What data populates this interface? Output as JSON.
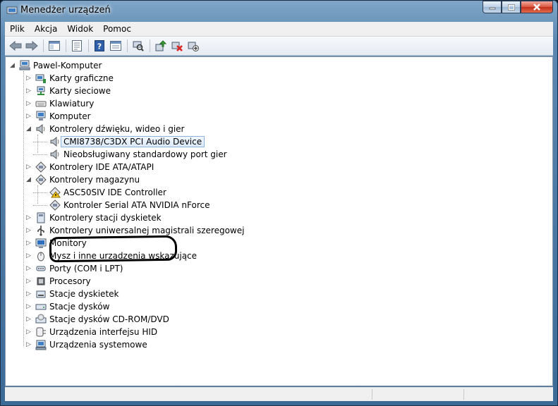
{
  "window": {
    "title": "Menedżer urządzeń"
  },
  "menu": [
    "Plik",
    "Akcja",
    "Widok",
    "Pomoc"
  ],
  "toolbar_icons": [
    "back-arrow-icon",
    "forward-arrow-icon",
    "show-hide-console-tree-icon",
    "properties-icon",
    "help-icon",
    "console-view-icon",
    "scan-hardware-changes-icon",
    "update-driver-icon",
    "uninstall-device-icon",
    "disable-device-icon"
  ],
  "tree": {
    "root": "Pawel-Komputer",
    "categories": [
      {
        "label": "Karty graficzne",
        "icon": "display-adapter-icon"
      },
      {
        "label": "Karty sieciowe",
        "icon": "network-adapter-icon"
      },
      {
        "label": "Klawiatury",
        "icon": "keyboard-icon"
      },
      {
        "label": "Komputer",
        "icon": "computer-icon"
      },
      {
        "label": "Kontrolery dźwięku, wideo i gier",
        "icon": "speaker-icon",
        "expanded": true,
        "children": [
          {
            "label": "CMI8738/C3DX PCI Audio Device",
            "icon": "speaker-icon",
            "selected": true
          },
          {
            "label": "Nieobsługiwany standardowy port gier",
            "icon": "speaker-icon"
          }
        ]
      },
      {
        "label": "Kontrolery IDE ATA/ATAPI",
        "icon": "ide-controller-icon"
      },
      {
        "label": "Kontrolery magazynu",
        "icon": "storage-controller-icon",
        "expanded": true,
        "children": [
          {
            "label": "ASC50SIV IDE Controller",
            "icon": "warning-device-icon"
          },
          {
            "label": "Kontroler Serial ATA NVIDIA nForce",
            "icon": "storage-controller-icon"
          }
        ]
      },
      {
        "label": "Kontrolery stacji dyskietek",
        "icon": "floppy-controller-icon"
      },
      {
        "label": "Kontrolery uniwersalnej magistrali szeregowej",
        "icon": "usb-icon"
      },
      {
        "label": "Monitory",
        "icon": "monitor-icon"
      },
      {
        "label": "Mysz i inne urządzenia wskazujące",
        "icon": "mouse-icon"
      },
      {
        "label": "Porty (COM i LPT)",
        "icon": "port-icon"
      },
      {
        "label": "Procesory",
        "icon": "processor-icon"
      },
      {
        "label": "Stacje dyskietek",
        "icon": "floppy-drive-icon"
      },
      {
        "label": "Stacje dysków",
        "icon": "disk-drive-icon"
      },
      {
        "label": "Stacje dysków CD-ROM/DVD",
        "icon": "cdrom-icon"
      },
      {
        "label": "Urządzenia interfejsu HID",
        "icon": "hid-icon"
      },
      {
        "label": "Urządzenia systemowe",
        "icon": "system-devices-icon"
      }
    ]
  }
}
